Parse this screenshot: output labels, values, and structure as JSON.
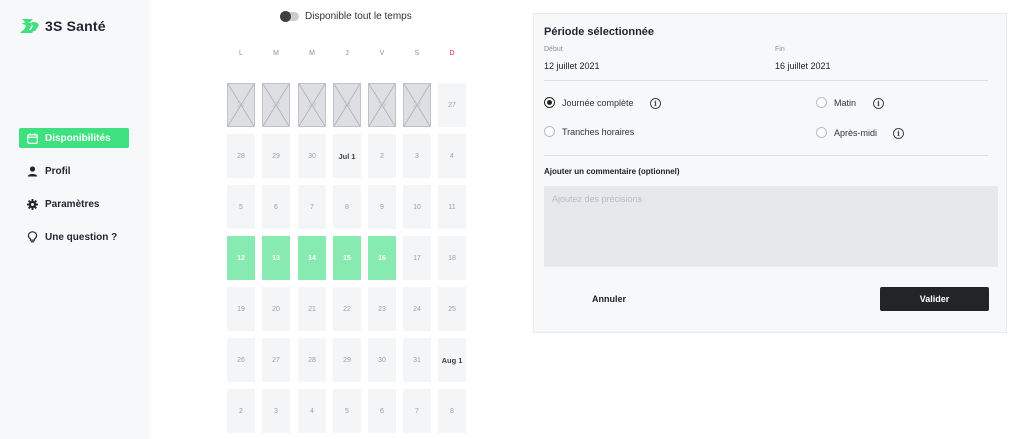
{
  "app": {
    "brand": "3S Santé",
    "logo_icon": "3s-logo-icon",
    "accent_color": "#3ee07f"
  },
  "sidebar": {
    "items": [
      {
        "label": "Disponibilités",
        "icon": "calendar-icon",
        "active": true
      },
      {
        "label": "Profil",
        "icon": "user-icon",
        "active": false
      },
      {
        "label": "Paramètres",
        "icon": "gear-icon",
        "active": false
      },
      {
        "label": "Une question ?",
        "icon": "lightbulb-icon",
        "active": false
      }
    ]
  },
  "toggle": {
    "label": "Disponible tout le temps",
    "on": false
  },
  "calendar": {
    "weekdays": [
      "L",
      "M",
      "M",
      "J",
      "V",
      "S",
      "D"
    ],
    "weeks": [
      [
        {
          "t": "21",
          "s": "past"
        },
        {
          "t": "22",
          "s": "past"
        },
        {
          "t": "23",
          "s": "past"
        },
        {
          "t": "24",
          "s": "past"
        },
        {
          "t": "25",
          "s": "past"
        },
        {
          "t": "26",
          "s": "past"
        },
        {
          "t": "27",
          "s": "normal"
        }
      ],
      [
        {
          "t": "28",
          "s": "normal"
        },
        {
          "t": "29",
          "s": "normal"
        },
        {
          "t": "30",
          "s": "normal"
        },
        {
          "t": "Jul 1",
          "s": "month-start"
        },
        {
          "t": "2",
          "s": "normal"
        },
        {
          "t": "3",
          "s": "normal"
        },
        {
          "t": "4",
          "s": "normal"
        }
      ],
      [
        {
          "t": "5",
          "s": "normal"
        },
        {
          "t": "6",
          "s": "normal"
        },
        {
          "t": "7",
          "s": "normal"
        },
        {
          "t": "8",
          "s": "normal"
        },
        {
          "t": "9",
          "s": "normal"
        },
        {
          "t": "10",
          "s": "normal"
        },
        {
          "t": "11",
          "s": "normal"
        }
      ],
      [
        {
          "t": "12",
          "s": "selected"
        },
        {
          "t": "13",
          "s": "selected"
        },
        {
          "t": "14",
          "s": "selected"
        },
        {
          "t": "15",
          "s": "selected"
        },
        {
          "t": "16",
          "s": "selected"
        },
        {
          "t": "17",
          "s": "normal"
        },
        {
          "t": "18",
          "s": "normal"
        }
      ],
      [
        {
          "t": "19",
          "s": "normal"
        },
        {
          "t": "20",
          "s": "normal"
        },
        {
          "t": "21",
          "s": "normal"
        },
        {
          "t": "22",
          "s": "normal"
        },
        {
          "t": "23",
          "s": "normal"
        },
        {
          "t": "24",
          "s": "normal"
        },
        {
          "t": "25",
          "s": "normal"
        }
      ],
      [
        {
          "t": "26",
          "s": "normal"
        },
        {
          "t": "27",
          "s": "normal"
        },
        {
          "t": "28",
          "s": "normal"
        },
        {
          "t": "29",
          "s": "normal"
        },
        {
          "t": "30",
          "s": "normal"
        },
        {
          "t": "31",
          "s": "normal"
        },
        {
          "t": "Aug 1",
          "s": "month-start"
        }
      ],
      [
        {
          "t": "2",
          "s": "normal"
        },
        {
          "t": "3",
          "s": "normal"
        },
        {
          "t": "4",
          "s": "normal"
        },
        {
          "t": "5",
          "s": "normal"
        },
        {
          "t": "6",
          "s": "normal"
        },
        {
          "t": "7",
          "s": "normal"
        },
        {
          "t": "8",
          "s": "normal"
        }
      ]
    ],
    "colors": {
      "selected": "#86eab1",
      "sunday": "#e0245e"
    }
  },
  "panel": {
    "title": "Période sélectionnée",
    "start_label": "Début",
    "start_value": "12 juillet 2021",
    "end_label": "Fin",
    "end_value": "16 juillet 2021",
    "options": {
      "full_day": {
        "label": "Journée complète",
        "checked": true
      },
      "time_slots": {
        "label": "Tranches horaires",
        "checked": false
      },
      "morning": {
        "label": "Matin",
        "checked": false
      },
      "afternoon": {
        "label": "Après-midi",
        "checked": false
      }
    },
    "info_glyph": "i",
    "comment_label": "Ajouter un commentaire (optionnel)",
    "comment_placeholder": "Ajoutez des précisions",
    "cancel_label": "Annuler",
    "validate_label": "Valider"
  }
}
